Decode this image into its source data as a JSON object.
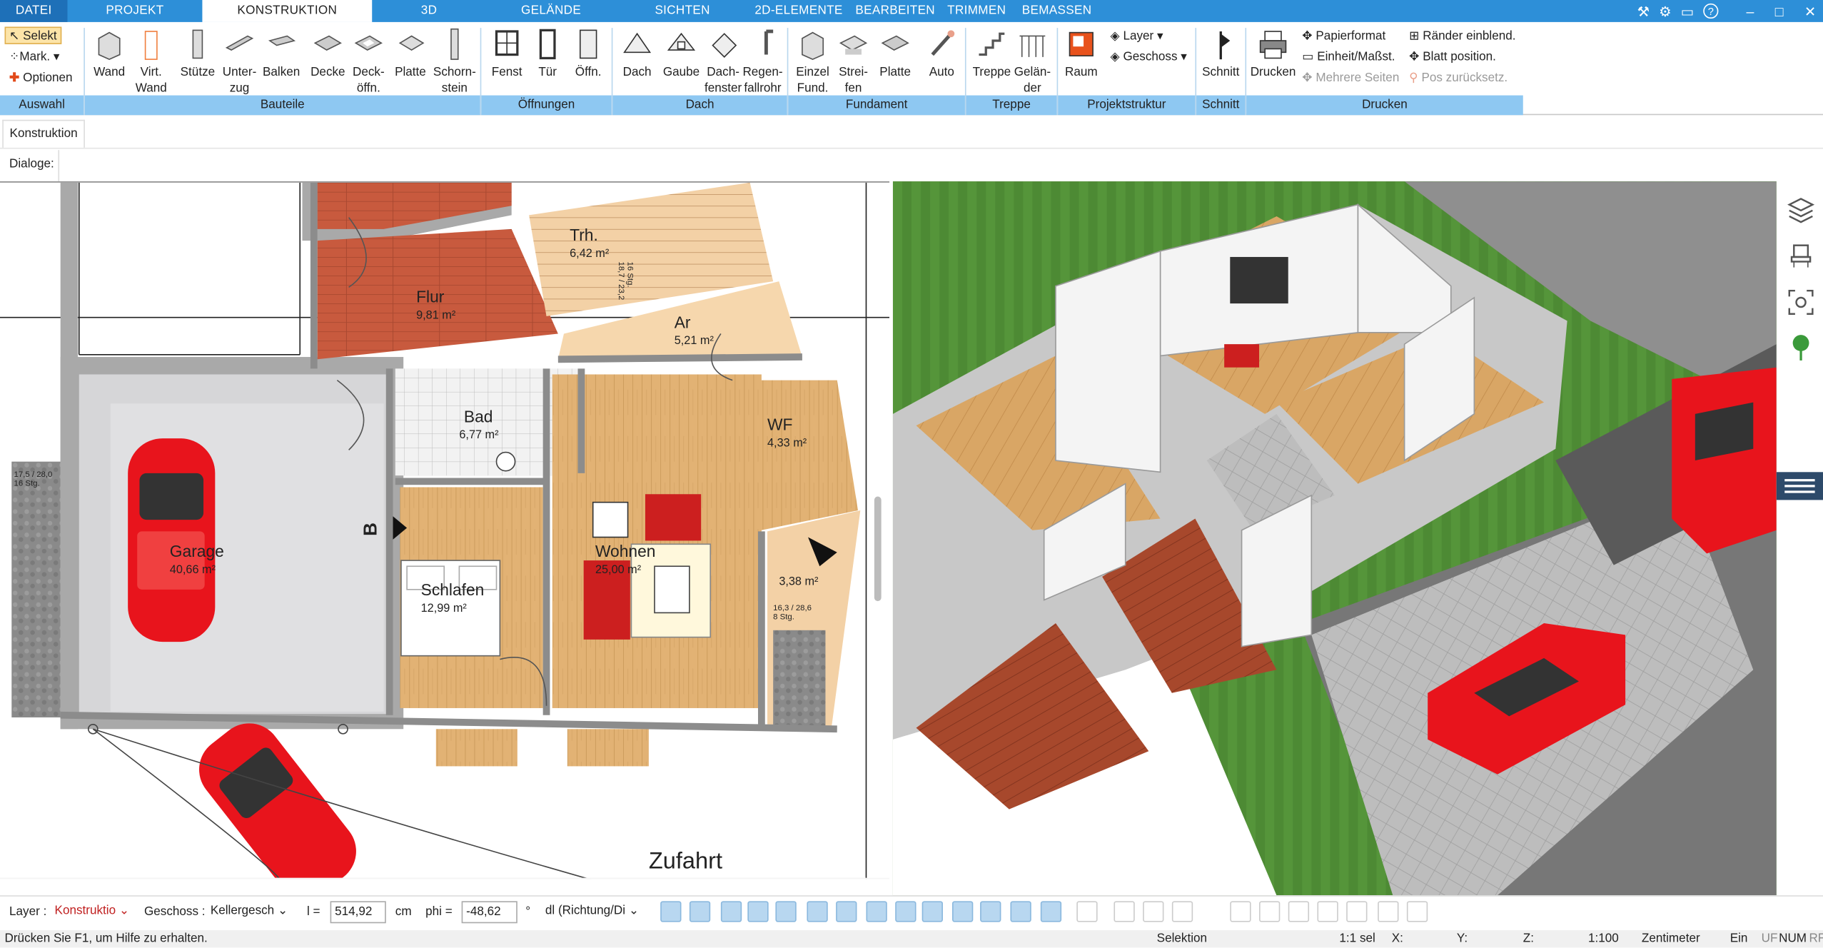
{
  "tabs": [
    "DATEI",
    "PROJEKT",
    "KONSTRUKTION",
    "3D",
    "GELÄNDE",
    "SICHTEN",
    "2D-ELEMENTE",
    "BEARBEITEN",
    "TRIMMEN",
    "BEMASSEN"
  ],
  "active_tab": "KONSTRUKTION",
  "ribbon": {
    "auswahl": {
      "label": "Auswahl",
      "selekt": "Selekt",
      "mark": "Mark.",
      "optionen": "Optionen"
    },
    "bauteile": {
      "label": "Bauteile",
      "items": [
        "Wand",
        "Virt.\nWand",
        "Stütze",
        "Unter-\nzug",
        "Balken",
        "Decke",
        "Deck-\nöffn.",
        "Platte",
        "Schorn-\nstein"
      ]
    },
    "oeffnungen": {
      "label": "Öffnungen",
      "items": [
        "Fenst",
        "Tür",
        "Öffn."
      ]
    },
    "dach": {
      "label": "Dach",
      "items": [
        "Dach",
        "Gaube",
        "Dach-\nfenster",
        "Regen-\nfallrohr"
      ]
    },
    "fundament": {
      "label": "Fundament",
      "items": [
        "Einzel\nFund.",
        "Strei-\nfen",
        "Platte",
        "Auto"
      ]
    },
    "treppe": {
      "label": "Treppe",
      "items": [
        "Treppe",
        "Gelän-\nder"
      ]
    },
    "projektstruktur": {
      "label": "Projektstruktur",
      "raum": "Raum",
      "layer": "Layer",
      "geschoss": "Geschoss"
    },
    "schnitt": {
      "label": "Schnitt",
      "item": "Schnitt"
    },
    "drucken": {
      "label": "Drucken",
      "item": "Drucken",
      "papierformat": "Papierformat",
      "einheit": "Einheit/Maßst.",
      "mehrere": "Mehrere Seiten",
      "raender": "Ränder einblend.",
      "blatt": "Blatt position.",
      "pos": "Pos zurücksetz."
    }
  },
  "tool_tab": "Konstruktion",
  "dialoge_label": "Dialoge:",
  "plan": {
    "rooms": [
      {
        "name": "Flur",
        "area": "9,81 m²"
      },
      {
        "name": "Trh.",
        "area": "6,42 m²"
      },
      {
        "name": "Ar",
        "area": "5,21 m²"
      },
      {
        "name": "Bad",
        "area": "6,77 m²"
      },
      {
        "name": "WF",
        "area": "4,33 m²"
      },
      {
        "name": "Garage",
        "area": "40,66 m²"
      },
      {
        "name": "Wohnen",
        "area": "25,00 m²"
      },
      {
        "name": "Schlafen",
        "area": "12,99 m²"
      },
      {
        "name": "",
        "area": "3,38 m²"
      }
    ],
    "stair_left": "17,5 / 28,0\n16 Stg.",
    "stair_right": "16,3 / 28,6\n8 Stg.",
    "stair_top": "16 Stg.\n18,7 / 23,2",
    "section_marker": "B",
    "zufahrt": "Zufahrt"
  },
  "statusbar": {
    "layer_label": "Layer :",
    "layer_value": "Konstruktio",
    "geschoss_label": "Geschoss :",
    "geschoss_value": "Kellergesch",
    "l_label": "l =",
    "l_value": "514,92",
    "l_unit": "cm",
    "phi_label": "phi =",
    "phi_value": "-48,62",
    "phi_unit": "°",
    "dl_value": "dl (Richtung/Di"
  },
  "footer": {
    "help": "Drücken Sie F1, um Hilfe zu erhalten.",
    "mode": "Selektion",
    "sel": "1:1 sel",
    "x": "X:",
    "y": "Y:",
    "z": "Z:",
    "scale": "1:100",
    "unit": "Zentimeter",
    "ein": "Ein",
    "uf": "UF",
    "num": "NUM",
    "rf": "RF"
  },
  "colors": {
    "accent": "#2d8fd8",
    "group_band": "#8ec8f2",
    "wall": "#bdbdbd",
    "wood": "#e6b77a",
    "tile_red": "#c0523c",
    "grass": "#4a7a2a",
    "car": "#e8141c"
  }
}
